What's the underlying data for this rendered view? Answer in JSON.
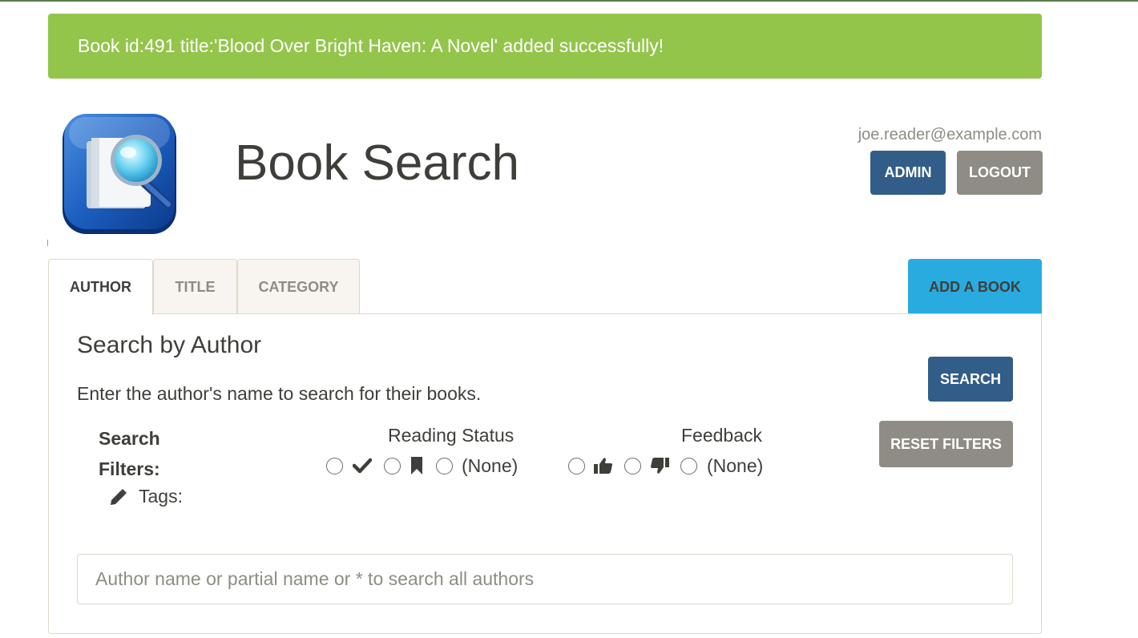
{
  "alert": {
    "message": "Book id:491 title:'Blood Over Bright Haven: A Novel' added successfully!"
  },
  "header": {
    "title": "Book Search",
    "user_email": "joe.reader@example.com",
    "admin_label": "ADMIN",
    "logout_label": "LOGOUT",
    "logo_icon": "book-search-logo-icon"
  },
  "tabs": [
    {
      "label": "AUTHOR",
      "active": true
    },
    {
      "label": "TITLE",
      "active": false
    },
    {
      "label": "CATEGORY",
      "active": false
    }
  ],
  "add_book_label": "ADD A BOOK",
  "panel": {
    "heading": "Search by Author",
    "description": "Enter the author's name to search for their books.",
    "search_label": "SEARCH",
    "reset_label": "RESET FILTERS",
    "filters": {
      "label_line1": "Search",
      "label_line2": "Filters:",
      "reading_status": {
        "label": "Reading Status",
        "options": [
          "checkmark-icon",
          "bookmark-icon",
          "(None)"
        ],
        "selected": null
      },
      "feedback": {
        "label": "Feedback",
        "options": [
          "thumbs-up-icon",
          "thumbs-down-icon",
          "(None)"
        ],
        "selected": null
      },
      "tags_label": "Tags:",
      "tags_icon": "pencil-icon"
    },
    "search_input": {
      "value": "",
      "placeholder": "Author name or partial name or * to search all authors"
    }
  },
  "colors": {
    "success": "#93c54b",
    "primary": "#325d88",
    "secondary": "#8e8c84",
    "info": "#29abe0"
  }
}
